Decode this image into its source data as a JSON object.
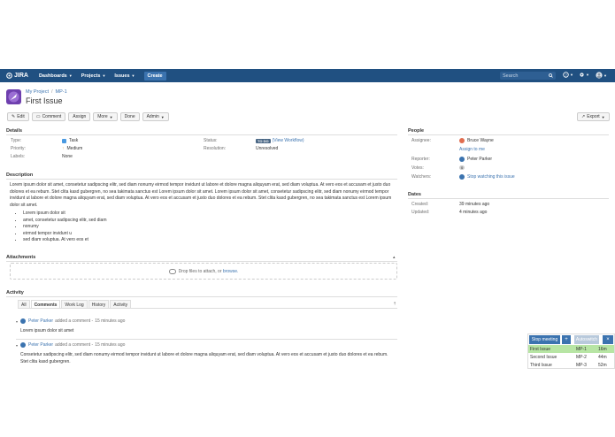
{
  "nav": {
    "logo": "JIRA",
    "items": [
      "Dashboards",
      "Projects",
      "Issues"
    ],
    "create": "Create",
    "search_placeholder": "Search"
  },
  "issue": {
    "breadcrumb_project": "My Project",
    "breadcrumb_key": "MP-1",
    "title": "First Issue"
  },
  "toolbar": {
    "edit": "Edit",
    "comment": "Comment",
    "assign": "Assign",
    "more": "More",
    "done": "Done",
    "admin": "Admin",
    "export": "Export"
  },
  "details": {
    "title": "Details",
    "type_label": "Type:",
    "type_value": "Task",
    "priority_label": "Priority:",
    "priority_value": "Medium",
    "labels_label": "Labels:",
    "labels_value": "None",
    "status_label": "Status:",
    "status_value": "TO DO",
    "status_link": "(View Workflow)",
    "resolution_label": "Resolution:",
    "resolution_value": "Unresolved"
  },
  "people": {
    "title": "People",
    "assignee_label": "Assignee:",
    "assignee_value": "Bruce Wayne",
    "assign_to_me": "Assign to me",
    "reporter_label": "Reporter:",
    "reporter_value": "Peter Parker",
    "votes_label": "Votes:",
    "votes_value": "0",
    "watchers_label": "Watchers:",
    "watchers_count": "1",
    "watchers_link": "Stop watching this issue"
  },
  "dates": {
    "title": "Dates",
    "created_label": "Created:",
    "created_value": "39 minutes ago",
    "updated_label": "Updated:",
    "updated_value": "4 minutes ago"
  },
  "description": {
    "title": "Description",
    "text": "Lorem ipsum dolor sit amet, consetetur sadipscing elitr, sed diam nonumy eirmod tempor invidunt ut labore et dolore magna aliquyam erat, sed diam voluptua. At vero eos et accusam et justo duo dolores et ea rebum. Stet clita kasd gubergren, no sea takimata sanctus est Lorem ipsum dolor sit amet. Lorem ipsum dolor sit amet, consetetur sadipscing elitr, sed diam nonumy eirmod tempor invidunt ut labore et dolore magna aliquyam erat, sed diam voluptua. At vero eos et accusam et justo duo dolores et ea rebum. Stet clita kasd gubergren, no sea takimata sanctus est Lorem ipsum dolor sit amet.",
    "bullets": [
      "Lorem ipsum dolor sit",
      "amet, consetetur sadipscing elitr, sed diam",
      "nonumy",
      "eirmod tempor invidunt u",
      "sed diam voluptua. At vero eos et"
    ]
  },
  "attachments": {
    "title": "Attachments",
    "drop_text": "Drop files to attach, or",
    "browse": "browse."
  },
  "activity": {
    "title": "Activity",
    "tabs": [
      "All",
      "Comments",
      "Work Log",
      "History",
      "Activity"
    ],
    "comments": [
      {
        "author": "Peter Parker",
        "action": "added a comment -",
        "time": "15 minutes ago",
        "body": "Lorem ipsum dolor sit amet"
      },
      {
        "author": "Peter Parker",
        "action": "added a comment -",
        "time": "15 minutes ago",
        "body": "Consetetur sadipscing elitr, sed diam nonumy eirmod tempor invidunt ut labore et dolore magna aliquyam erat, sed diam voluptua. At vero eos et accusam et justo duo dolores et ea rebum. Stet clita kasd gubergren."
      }
    ]
  },
  "meeting": {
    "stop": "Stop meeting",
    "plus": "+",
    "autoswitch": "Autoswitch",
    "close": "×",
    "rows": [
      {
        "name": "First Issue",
        "key": "MP-1",
        "time": "16m"
      },
      {
        "name": "Second Issue",
        "key": "MP-2",
        "time": "44m"
      },
      {
        "name": "Third Issue",
        "key": "MP-3",
        "time": "52m"
      }
    ]
  }
}
